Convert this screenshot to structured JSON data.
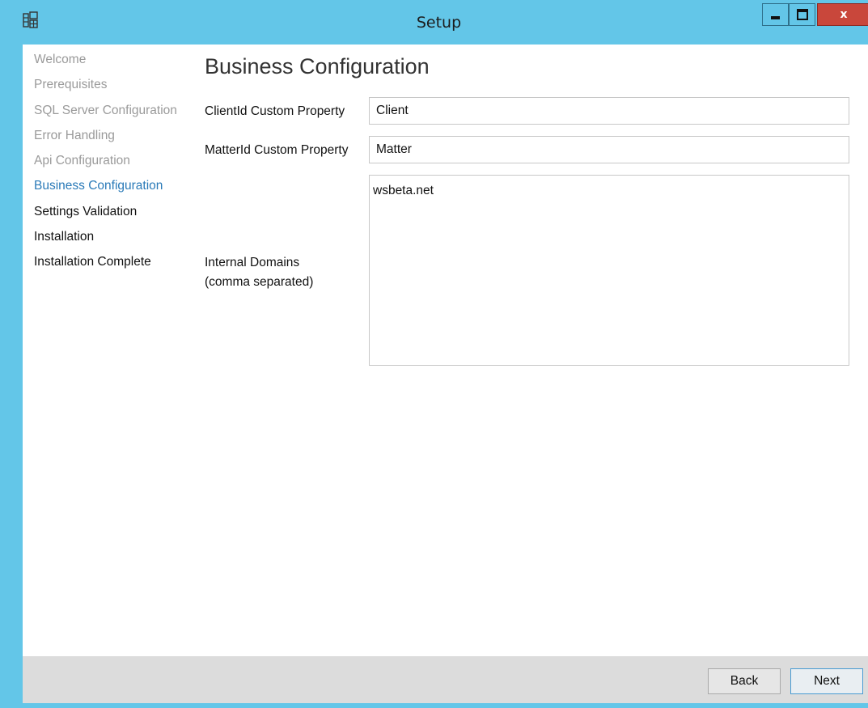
{
  "window": {
    "title": "Setup",
    "close_glyph": "x"
  },
  "nav": {
    "items": [
      {
        "label": "Welcome",
        "state": "done"
      },
      {
        "label": "Prerequisites",
        "state": "done"
      },
      {
        "label": "SQL Server Configuration",
        "state": "done"
      },
      {
        "label": "Error Handling",
        "state": "done"
      },
      {
        "label": "Api Configuration",
        "state": "done"
      },
      {
        "label": "Business Configuration",
        "state": "current"
      },
      {
        "label": "Settings Validation",
        "state": "pending"
      },
      {
        "label": "Installation",
        "state": "pending"
      },
      {
        "label": "Installation Complete",
        "state": "pending"
      }
    ]
  },
  "page": {
    "title": "Business Configuration"
  },
  "form": {
    "client_id_label": "ClientId Custom Property",
    "client_id_value": "Client",
    "matter_id_label": "MatterId Custom Property",
    "matter_id_value": "Matter",
    "domains_label_line1": "Internal Domains",
    "domains_label_line2": "(comma separated)",
    "domains_value": "wsbeta.net"
  },
  "footer": {
    "back_label": "Back",
    "next_label": "Next"
  },
  "colors": {
    "titlebar": "#63c6e8",
    "close_button": "#c9473b",
    "nav_done": "#9a9a9a",
    "nav_current": "#2a7ab8",
    "footer_bg": "#dcdcdc"
  },
  "icons": {
    "app": "setup-app-icon",
    "minimize": "minimize-icon",
    "maximize": "maximize-icon",
    "close": "close-icon"
  }
}
